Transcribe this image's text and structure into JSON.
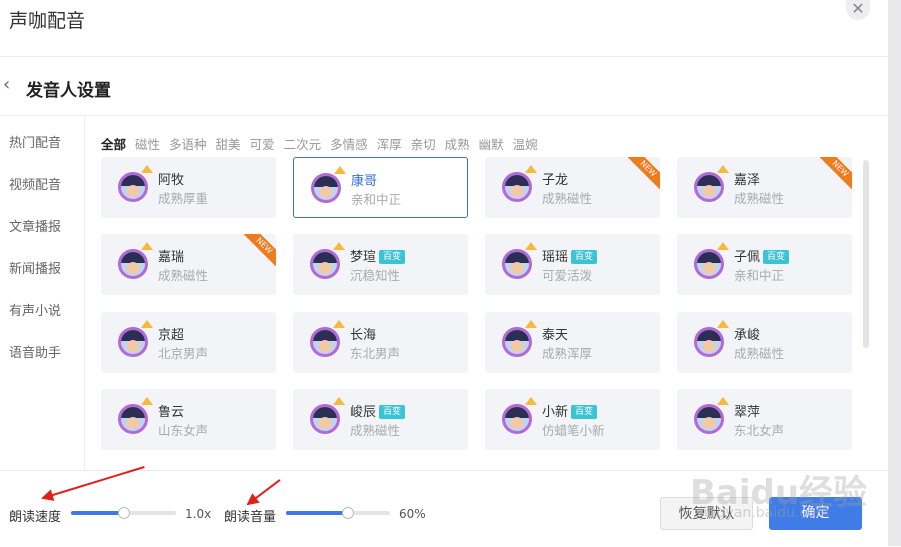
{
  "window": {
    "title": "声咖配音",
    "close_glyph": "✕"
  },
  "header": {
    "title": "发音人设置",
    "back_glyph": "‹"
  },
  "sidebar": {
    "items": [
      {
        "label": "热门配音",
        "active": true
      },
      {
        "label": "视频配音",
        "active": false
      },
      {
        "label": "文章播报",
        "active": false
      },
      {
        "label": "新闻播报",
        "active": false
      },
      {
        "label": "有声小说",
        "active": false
      },
      {
        "label": "语音助手",
        "active": false
      }
    ]
  },
  "filters": [
    "全部",
    "磁性",
    "多语种",
    "甜美",
    "可爱",
    "二次元",
    "多情感",
    "浑厚",
    "亲切",
    "成熟",
    "幽默",
    "温婉"
  ],
  "voices": [
    {
      "name": "阿牧",
      "desc": "成熟厚重",
      "badge": "",
      "ribbon": ""
    },
    {
      "name": "康哥",
      "desc": "亲和中正",
      "badge": "",
      "ribbon": "",
      "selected": true
    },
    {
      "name": "子龙",
      "desc": "成熟磁性",
      "badge": "",
      "ribbon": "NEW"
    },
    {
      "name": "嘉泽",
      "desc": "成熟磁性",
      "badge": "",
      "ribbon": "NEW"
    },
    {
      "name": "嘉瑞",
      "desc": "成熟磁性",
      "badge": "",
      "ribbon": "NEW"
    },
    {
      "name": "梦瑄",
      "desc": "沉稳知性",
      "badge": "百变",
      "ribbon": ""
    },
    {
      "name": "瑶瑶",
      "desc": "可爱活泼",
      "badge": "百变",
      "ribbon": ""
    },
    {
      "name": "子佩",
      "desc": "亲和中正",
      "badge": "百变",
      "ribbon": ""
    },
    {
      "name": "京超",
      "desc": "北京男声",
      "badge": "",
      "ribbon": ""
    },
    {
      "name": "长海",
      "desc": "东北男声",
      "badge": "",
      "ribbon": ""
    },
    {
      "name": "泰天",
      "desc": "成熟浑厚",
      "badge": "",
      "ribbon": ""
    },
    {
      "name": "承峻",
      "desc": "成熟磁性",
      "badge": "",
      "ribbon": ""
    },
    {
      "name": "鲁云",
      "desc": "山东女声",
      "badge": "",
      "ribbon": ""
    },
    {
      "name": "峻辰",
      "desc": "成熟磁性",
      "badge": "百变",
      "ribbon": ""
    },
    {
      "name": "小新",
      "desc": "仿蜡笔小新",
      "badge": "百变",
      "ribbon": ""
    },
    {
      "name": "翠萍",
      "desc": "东北女声",
      "badge": "",
      "ribbon": ""
    }
  ],
  "controls": {
    "speed": {
      "label": "朗读速度",
      "value_text": "1.0x",
      "level": 0.5
    },
    "volume": {
      "label": "朗读音量",
      "value_text": "60%",
      "level": 0.6
    }
  },
  "buttons": {
    "reset": "恢复默认",
    "ok": "确定"
  },
  "watermark": {
    "text": "Baidu经验",
    "url": "jingyan.baidu.com"
  },
  "colors": {
    "accent": "#3f7ce8",
    "ribbon": "#f07b1e",
    "badge": "#3dc4d2",
    "arrow": "#e0201b"
  }
}
